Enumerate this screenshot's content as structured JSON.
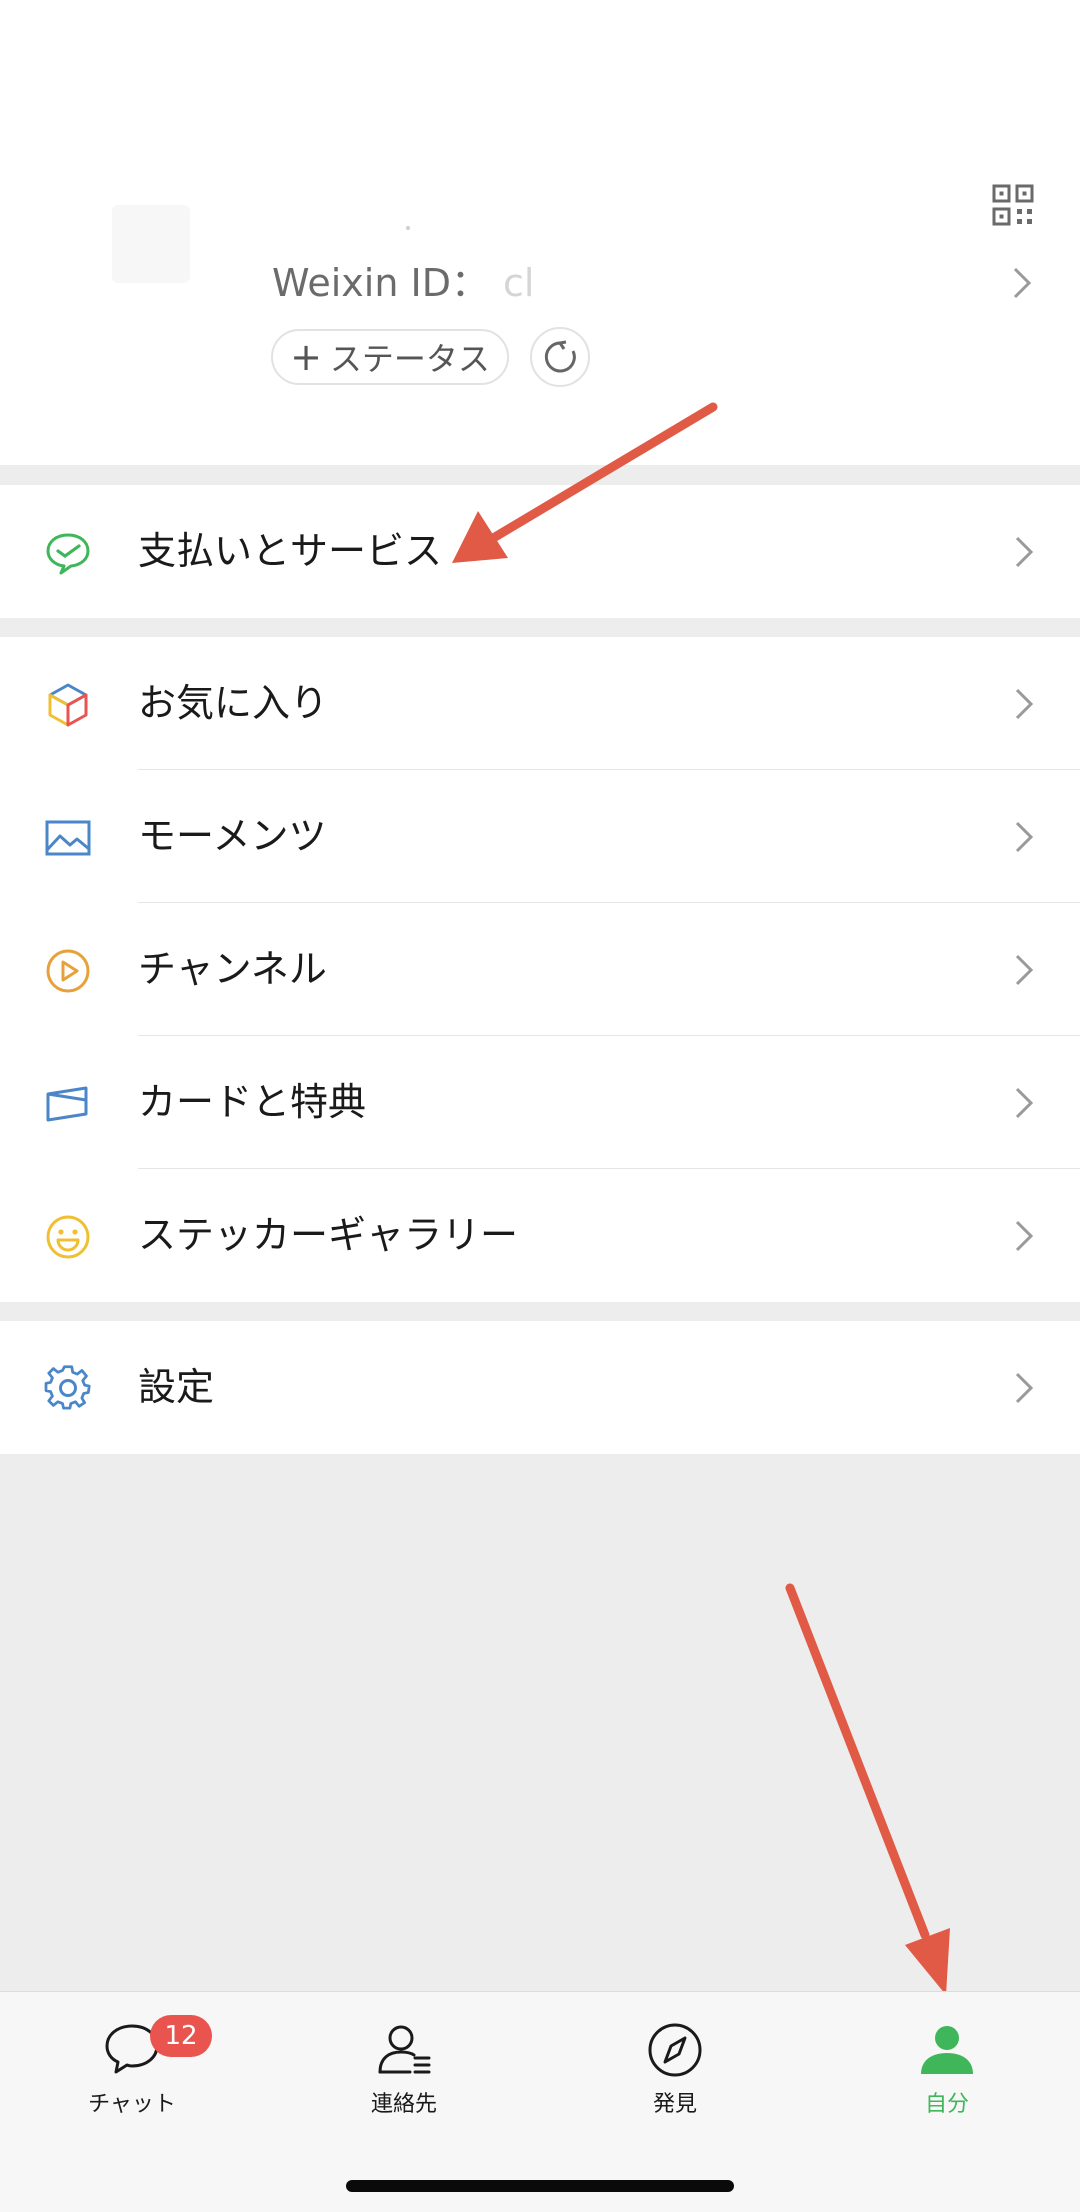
{
  "profile": {
    "weixin_id_label": "Weixin ID：",
    "weixin_id_value": "cl",
    "status_button_label": "ステータス",
    "icons": {
      "qr": "qr-code-icon",
      "refresh": "refresh-icon",
      "chevron": "chevron-right-icon"
    }
  },
  "menu": {
    "pay": {
      "label": "支払いとサービス",
      "icon": "pay-services-icon",
      "color": "#3fb65a"
    },
    "favorites": {
      "label": "お気に入り",
      "icon": "favorites-cube-icon"
    },
    "moments": {
      "label": "モーメンツ",
      "icon": "moments-image-icon",
      "color": "#4a86c8"
    },
    "channels": {
      "label": "チャンネル",
      "icon": "channels-play-icon",
      "color": "#e8a13a"
    },
    "cards": {
      "label": "カードと特典",
      "icon": "card-wallet-icon",
      "color": "#4a86c8"
    },
    "stickers": {
      "label": "ステッカーギャラリー",
      "icon": "sticker-smile-icon",
      "color": "#f0c032"
    },
    "settings": {
      "label": "設定",
      "icon": "settings-gear-icon",
      "color": "#4a86c8"
    }
  },
  "tabbar": {
    "chats": {
      "label": "チャット",
      "badge": "12",
      "icon": "chat-bubble-icon"
    },
    "contacts": {
      "label": "連絡先",
      "icon": "contacts-person-icon"
    },
    "discover": {
      "label": "発見",
      "icon": "compass-icon"
    },
    "me": {
      "label": "自分",
      "icon": "me-person-icon",
      "active": true,
      "color": "#3fb65a"
    }
  },
  "annotation_color": "#e05a46"
}
